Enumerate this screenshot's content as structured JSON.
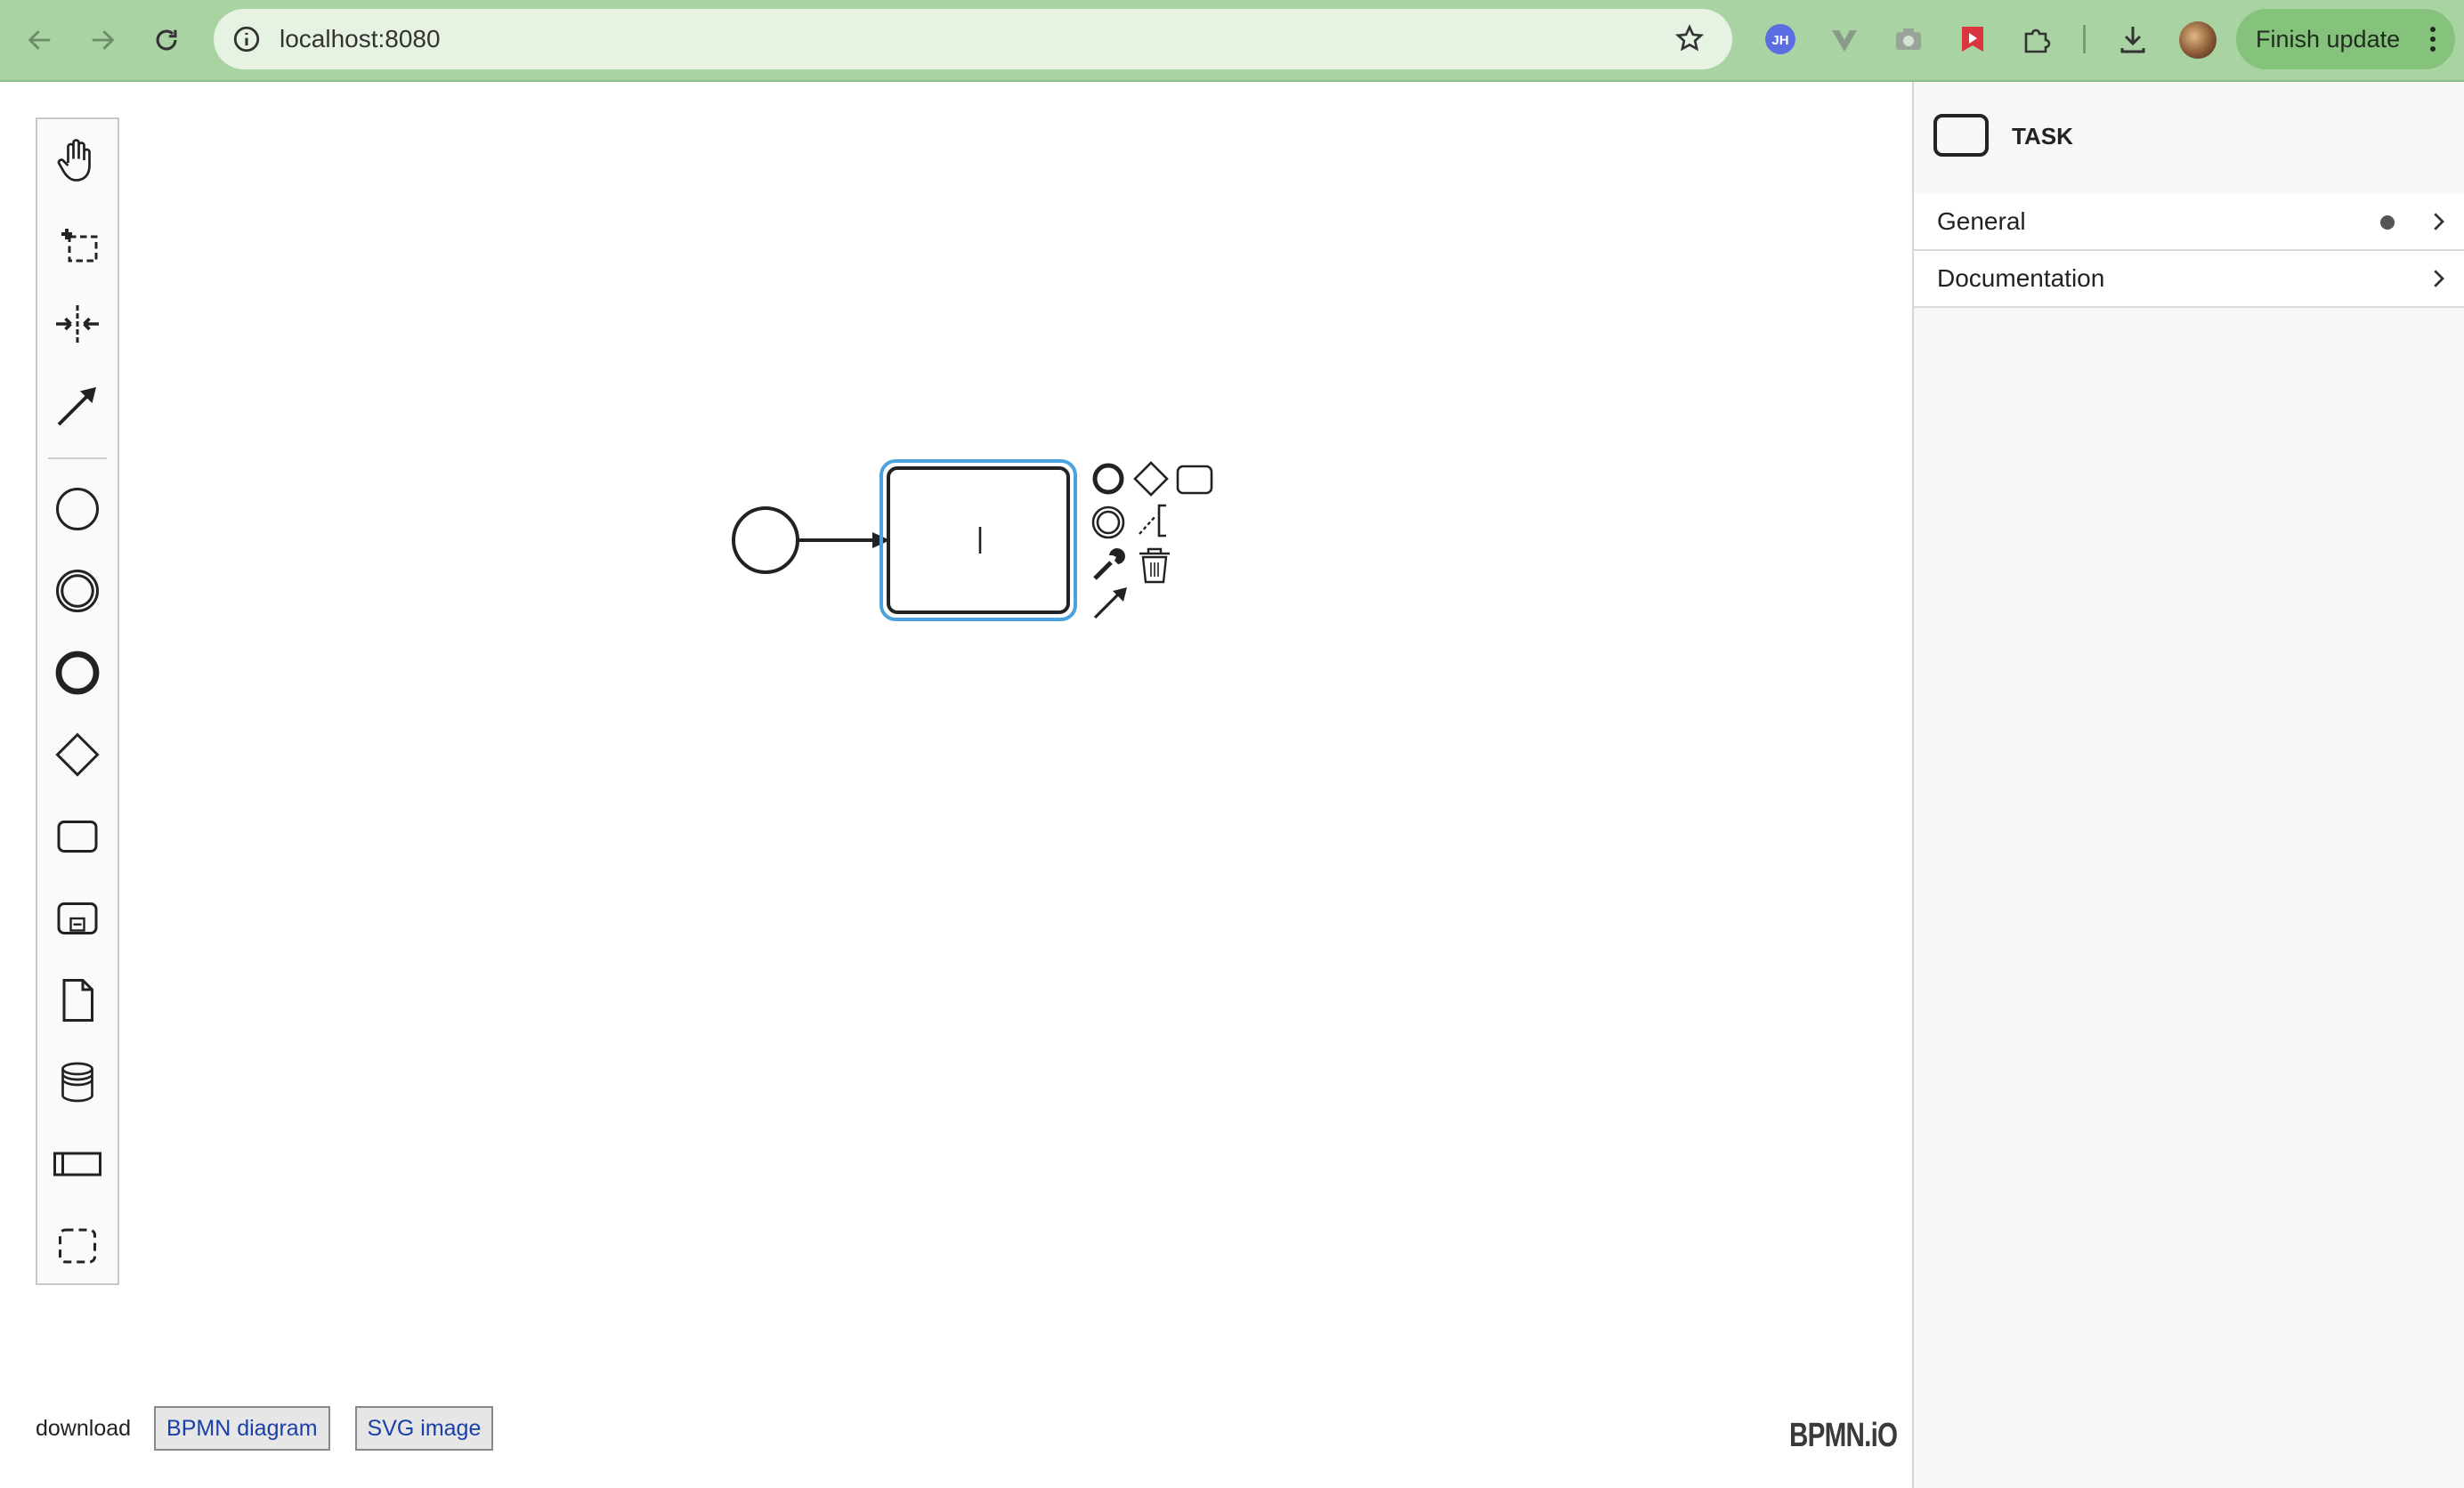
{
  "browser": {
    "url": "localhost:8080",
    "finish_update_label": "Finish update",
    "extensions": [
      "jh-extension-icon",
      "vue-devtools-icon",
      "camera-icon",
      "red-extension-icon",
      "puzzle-icon",
      "download-icon"
    ]
  },
  "palette": {
    "tools": [
      "hand-tool",
      "lasso-tool",
      "space-tool",
      "global-connect-tool",
      "start-event",
      "intermediate-event",
      "end-event",
      "gateway",
      "task",
      "subprocess",
      "data-object",
      "data-store",
      "pool",
      "group"
    ]
  },
  "diagram": {
    "selected_element": "task",
    "context_pad": [
      "end-event",
      "gateway",
      "task",
      "intermediate-event",
      "text-annotation",
      "change-type",
      "delete",
      "connect"
    ]
  },
  "download": {
    "label": "download",
    "bpmn_button": "BPMN diagram",
    "svg_button": "SVG image"
  },
  "brand": {
    "logo": "BPMN.iO"
  },
  "properties": {
    "element_type": "TASK",
    "groups": [
      {
        "label": "General",
        "has_indicator": true
      },
      {
        "label": "Documentation",
        "has_indicator": false
      }
    ]
  },
  "colors": {
    "chrome_bg": "#a9d3a2",
    "selection": "#4aa3df",
    "link_blue": "#1a3fa8"
  }
}
